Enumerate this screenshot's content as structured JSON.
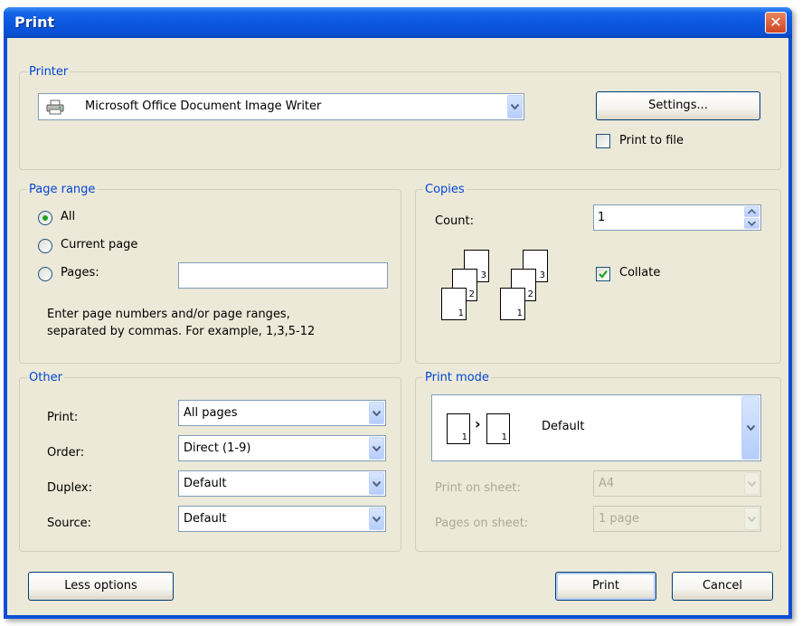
{
  "window": {
    "title": "Print",
    "close_glyph": "✕"
  },
  "printer": {
    "legend": "Printer",
    "selected": "Microsoft Office Document Image Writer",
    "icon": "printer-icon",
    "settings_label": "Settings...",
    "print_to_file_label": "Print to file",
    "print_to_file_checked": false
  },
  "page_range": {
    "legend": "Page range",
    "options": [
      "All",
      "Current page",
      "Pages:"
    ],
    "selected_index": 0,
    "pages_value": "",
    "hint_line1": "Enter page numbers and/or page ranges,",
    "hint_line2": "separated by commas. For example, 1,3,5-12"
  },
  "copies": {
    "legend": "Copies",
    "count_label": "Count:",
    "count_value": "1",
    "collate_label": "Collate",
    "collate_checked": true,
    "page_numbers": [
      "3",
      "2",
      "1"
    ]
  },
  "other": {
    "legend": "Other",
    "rows": [
      {
        "label": "Print:",
        "value": "All pages"
      },
      {
        "label": "Order:",
        "value": "Direct (1-9)"
      },
      {
        "label": "Duplex:",
        "value": "Default"
      },
      {
        "label": "Source:",
        "value": "Default"
      }
    ]
  },
  "print_mode": {
    "legend": "Print mode",
    "selected": "Default",
    "page_a": "1",
    "page_b": "1",
    "arrow": "›",
    "print_on_sheet_label": "Print on sheet:",
    "print_on_sheet_value": "A4",
    "pages_on_sheet_label": "Pages on sheet:",
    "pages_on_sheet_value": "1 page"
  },
  "footer": {
    "less_options_label": "Less options",
    "print_label": "Print",
    "cancel_label": "Cancel"
  },
  "colors": {
    "title_bar": "#0a50d4",
    "dialog_bg": "#ece9d8",
    "group_legend": "#0046d5",
    "check_mark": "#21a121"
  }
}
